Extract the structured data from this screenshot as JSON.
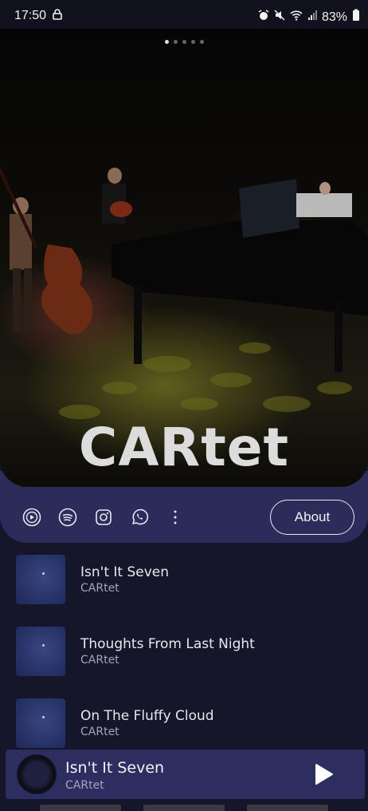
{
  "status_bar": {
    "time": "17:50",
    "battery": "83%",
    "icons": [
      "lock-icon",
      "alarm-icon",
      "mute-icon",
      "wifi-icon",
      "signal-icon",
      "battery-icon"
    ]
  },
  "hero": {
    "band_name": "CARtet",
    "page_count": 5,
    "active_page": 1
  },
  "actions": {
    "icons": [
      "youtube-play-icon",
      "spotify-icon",
      "instagram-icon",
      "whatsapp-icon",
      "more-vertical-icon"
    ],
    "about_label": "About"
  },
  "tracks": [
    {
      "title": "Isn't It Seven",
      "artist": "CARtet"
    },
    {
      "title": "Thoughts From Last Night",
      "artist": "CARtet"
    },
    {
      "title": "On The Fluffy Cloud",
      "artist": "CARtet"
    }
  ],
  "now_playing": {
    "title": "Isn't It Seven",
    "artist": "CARtet"
  },
  "colors": {
    "background": "#16162a",
    "accent_bar": "#2a2c5a",
    "player_bar": "#2c2e60"
  }
}
